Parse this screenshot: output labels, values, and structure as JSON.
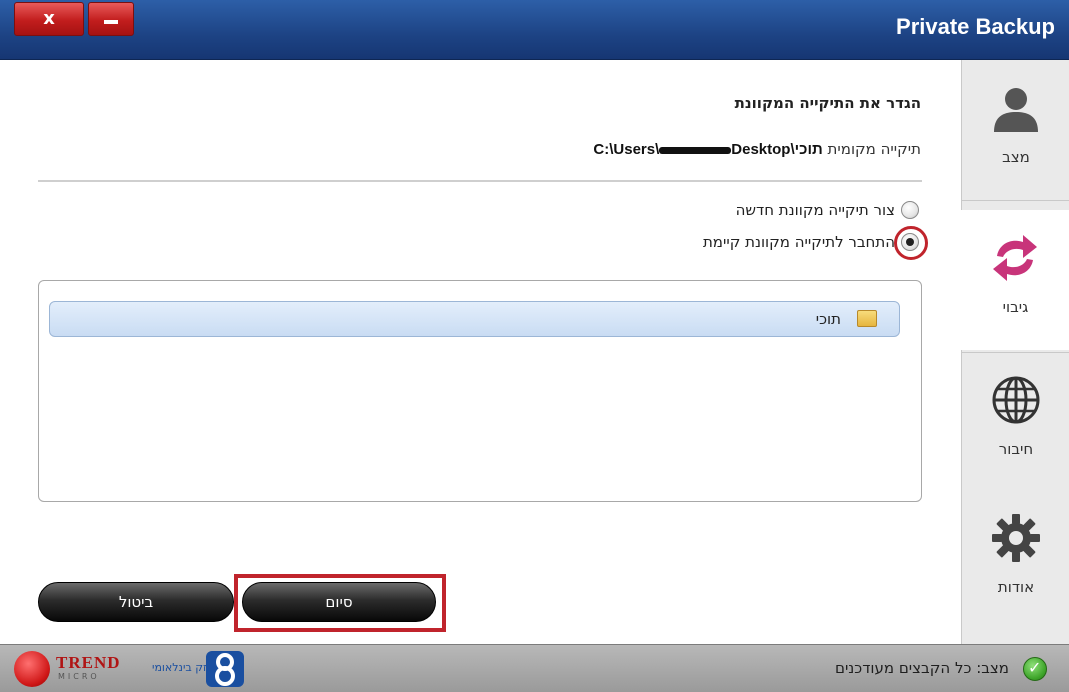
{
  "window": {
    "title": "Private Backup",
    "close_glyph": "x",
    "minimize_glyph": "–"
  },
  "sidenav": {
    "items": [
      {
        "label": "מצב",
        "icon": "user-icon",
        "active": false
      },
      {
        "label": "גיבוי",
        "icon": "sync-arrows-icon",
        "active": true
      },
      {
        "label": "חיבור",
        "icon": "globe-icon",
        "active": false
      },
      {
        "label": "אודות",
        "icon": "gear-icon",
        "active": false
      }
    ]
  },
  "main": {
    "section_title": "הגדר את התיקייה המקוונת",
    "local_folder_label": "תיקייה מקומית",
    "local_folder_path_start": "C:\\Users\\",
    "local_folder_path_end": "Desktop\\תוכי",
    "options": [
      {
        "label": "צור תיקייה מקוונת חדשה",
        "checked": false
      },
      {
        "label": "התחבר לתיקייה מקוונת קיימת",
        "checked": true
      }
    ],
    "folders": [
      {
        "name": "תוכי",
        "selected": true
      }
    ],
    "cancel_button": "ביטול",
    "finish_button": "סיום"
  },
  "status": {
    "label": "מצב:",
    "text": "כל הקבצים מעודכנים",
    "icon": "check-circle-icon"
  },
  "branding": {
    "trend_name": "TREND",
    "trend_sub": "MICRO",
    "bezeq_text": "בזק בינלאומי"
  },
  "colors": {
    "titlebar": "#1d4384",
    "highlight_red": "#c0242c",
    "selection_blue": "#c9dcf3",
    "status_green": "#3ea52a"
  }
}
